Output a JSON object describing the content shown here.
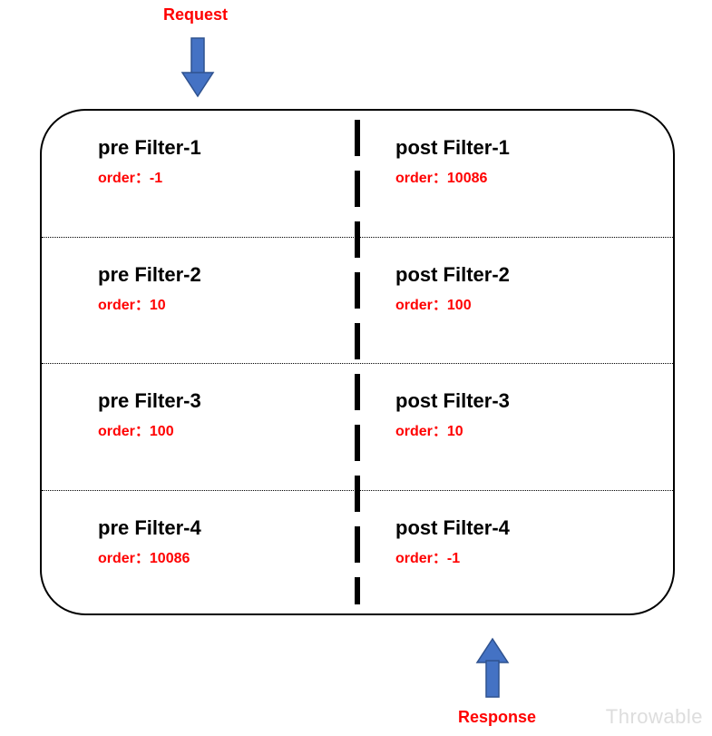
{
  "labels": {
    "request": "Request",
    "response": "Response",
    "orderPrefix": "order：",
    "watermark": "Throwable"
  },
  "filters": [
    {
      "pre": {
        "name": "pre Filter-1",
        "order": "-1"
      },
      "post": {
        "name": "post Filter-1",
        "order": "10086"
      }
    },
    {
      "pre": {
        "name": "pre Filter-2",
        "order": "10"
      },
      "post": {
        "name": "post Filter-2",
        "order": "100"
      }
    },
    {
      "pre": {
        "name": "pre Filter-3",
        "order": "100"
      },
      "post": {
        "name": "post Filter-3",
        "order": "10"
      }
    },
    {
      "pre": {
        "name": "pre Filter-4",
        "order": "10086"
      },
      "post": {
        "name": "post Filter-4",
        "order": "-1"
      }
    }
  ],
  "colors": {
    "accent": "#ff0000",
    "arrow": "#4472c4",
    "arrowStroke": "#2f528f"
  }
}
